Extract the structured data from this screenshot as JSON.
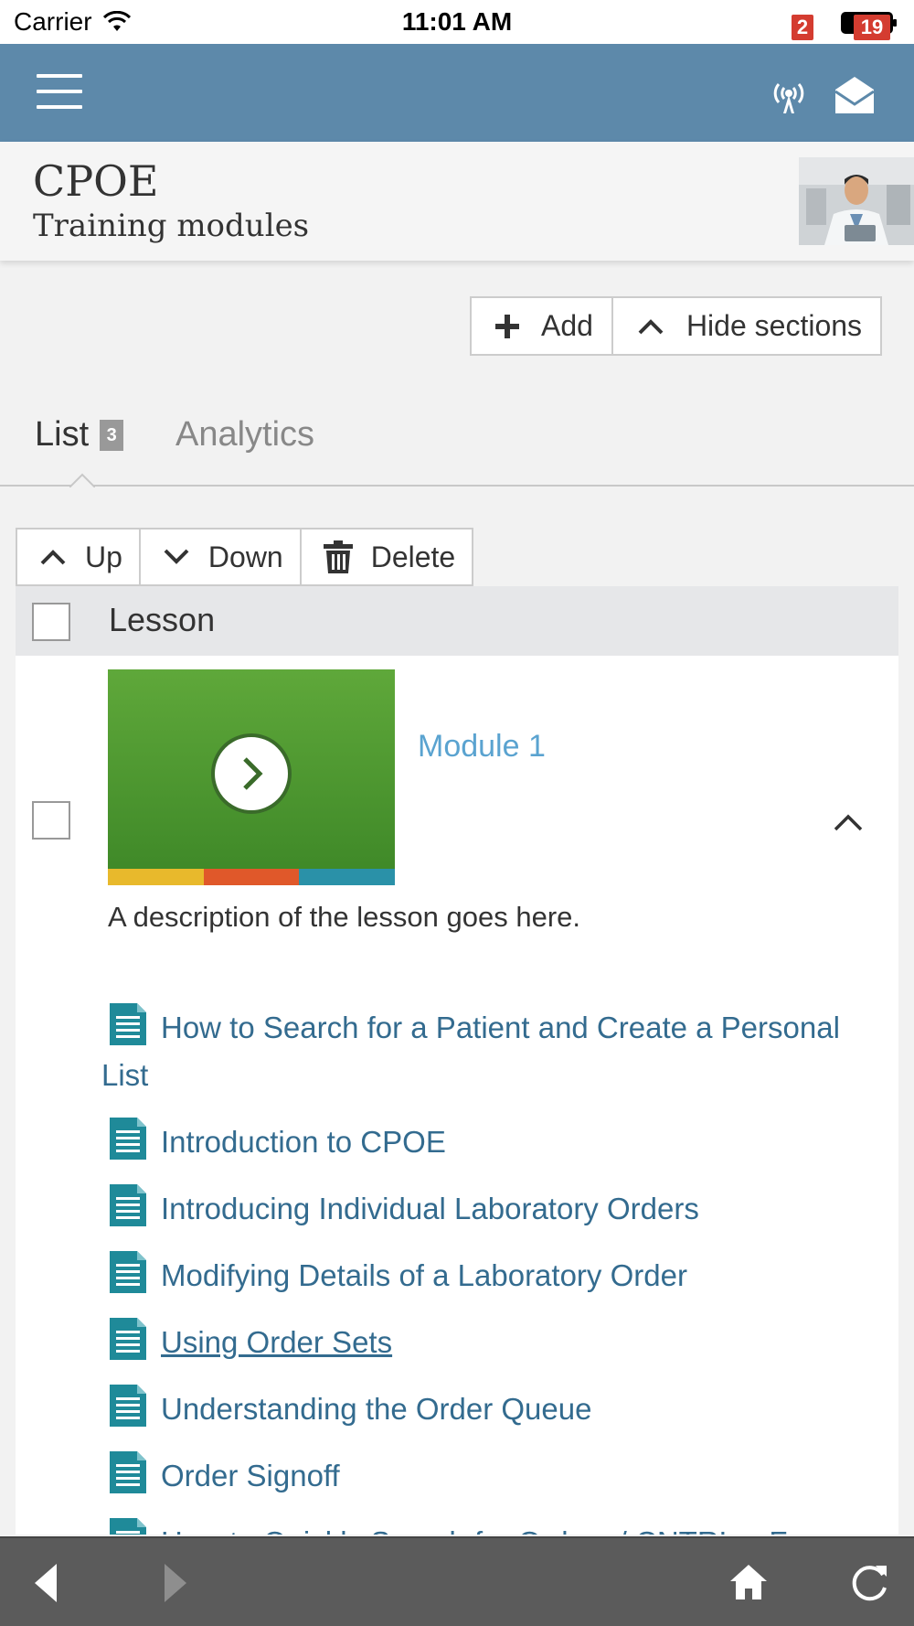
{
  "status_bar": {
    "carrier": "Carrier",
    "time": "11:01 AM"
  },
  "header": {
    "notification_count": "2",
    "message_count": "19",
    "accent_color": "#5d89aa"
  },
  "course": {
    "title": "CPOE",
    "subtitle": "Training modules"
  },
  "actions": {
    "add_label": "Add",
    "hide_sections_label": "Hide sections"
  },
  "tabs": {
    "list_label": "List",
    "list_count": "3",
    "analytics_label": "Analytics"
  },
  "list_toolbar": {
    "up_label": "Up",
    "down_label": "Down",
    "delete_label": "Delete"
  },
  "table": {
    "header_label": "Lesson"
  },
  "module": {
    "title": "Module 1",
    "description": "A description of the lesson goes here.",
    "stripe_colors": [
      "#e8b92c",
      "#e0582a",
      "#2a91a8"
    ],
    "lessons": [
      "How to Search for a Patient and Create a Personal List",
      "Introduction to CPOE",
      "Introducing Individual Laboratory Orders",
      "Modifying Details of a Laboratory Order",
      "Using Order Sets",
      "Understanding the Order Queue",
      "Order Signoff",
      "How to Quickly Search for Orders / CNTRL + F"
    ]
  },
  "icons": {
    "menu": "menu-icon",
    "signal": "signal-icon",
    "mail": "mail-icon",
    "document": "document-icon",
    "back": "back-arrow-icon",
    "forward": "forward-arrow-icon",
    "home": "home-icon",
    "reload": "reload-icon"
  }
}
